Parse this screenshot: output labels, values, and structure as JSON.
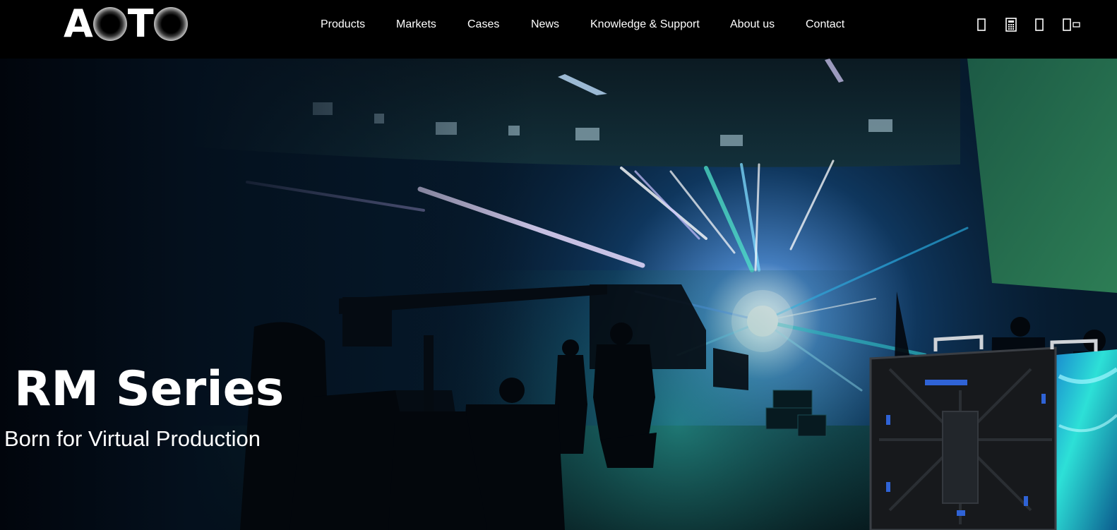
{
  "header": {
    "logo_text": "AOTO",
    "nav": [
      {
        "label": "Products"
      },
      {
        "label": "Markets"
      },
      {
        "label": "Cases"
      },
      {
        "label": "News"
      },
      {
        "label": "Knowledge & Support"
      },
      {
        "label": "About us"
      },
      {
        "label": "Contact"
      }
    ],
    "tools": [
      {
        "icon": "mobile-icon"
      },
      {
        "icon": "calculator-icon"
      },
      {
        "icon": "search-icon"
      },
      {
        "icon": "language-icon"
      }
    ]
  },
  "hero": {
    "title": "RM Series",
    "subtitle": "Born for Virtual Production"
  },
  "colors": {
    "header_bg": "#000000",
    "text": "#ffffff",
    "hero_dark": "#030a14",
    "hero_teal": "#1f8f86",
    "hero_blue": "#2c6fd6",
    "green_screen": "#1f6a4a"
  }
}
